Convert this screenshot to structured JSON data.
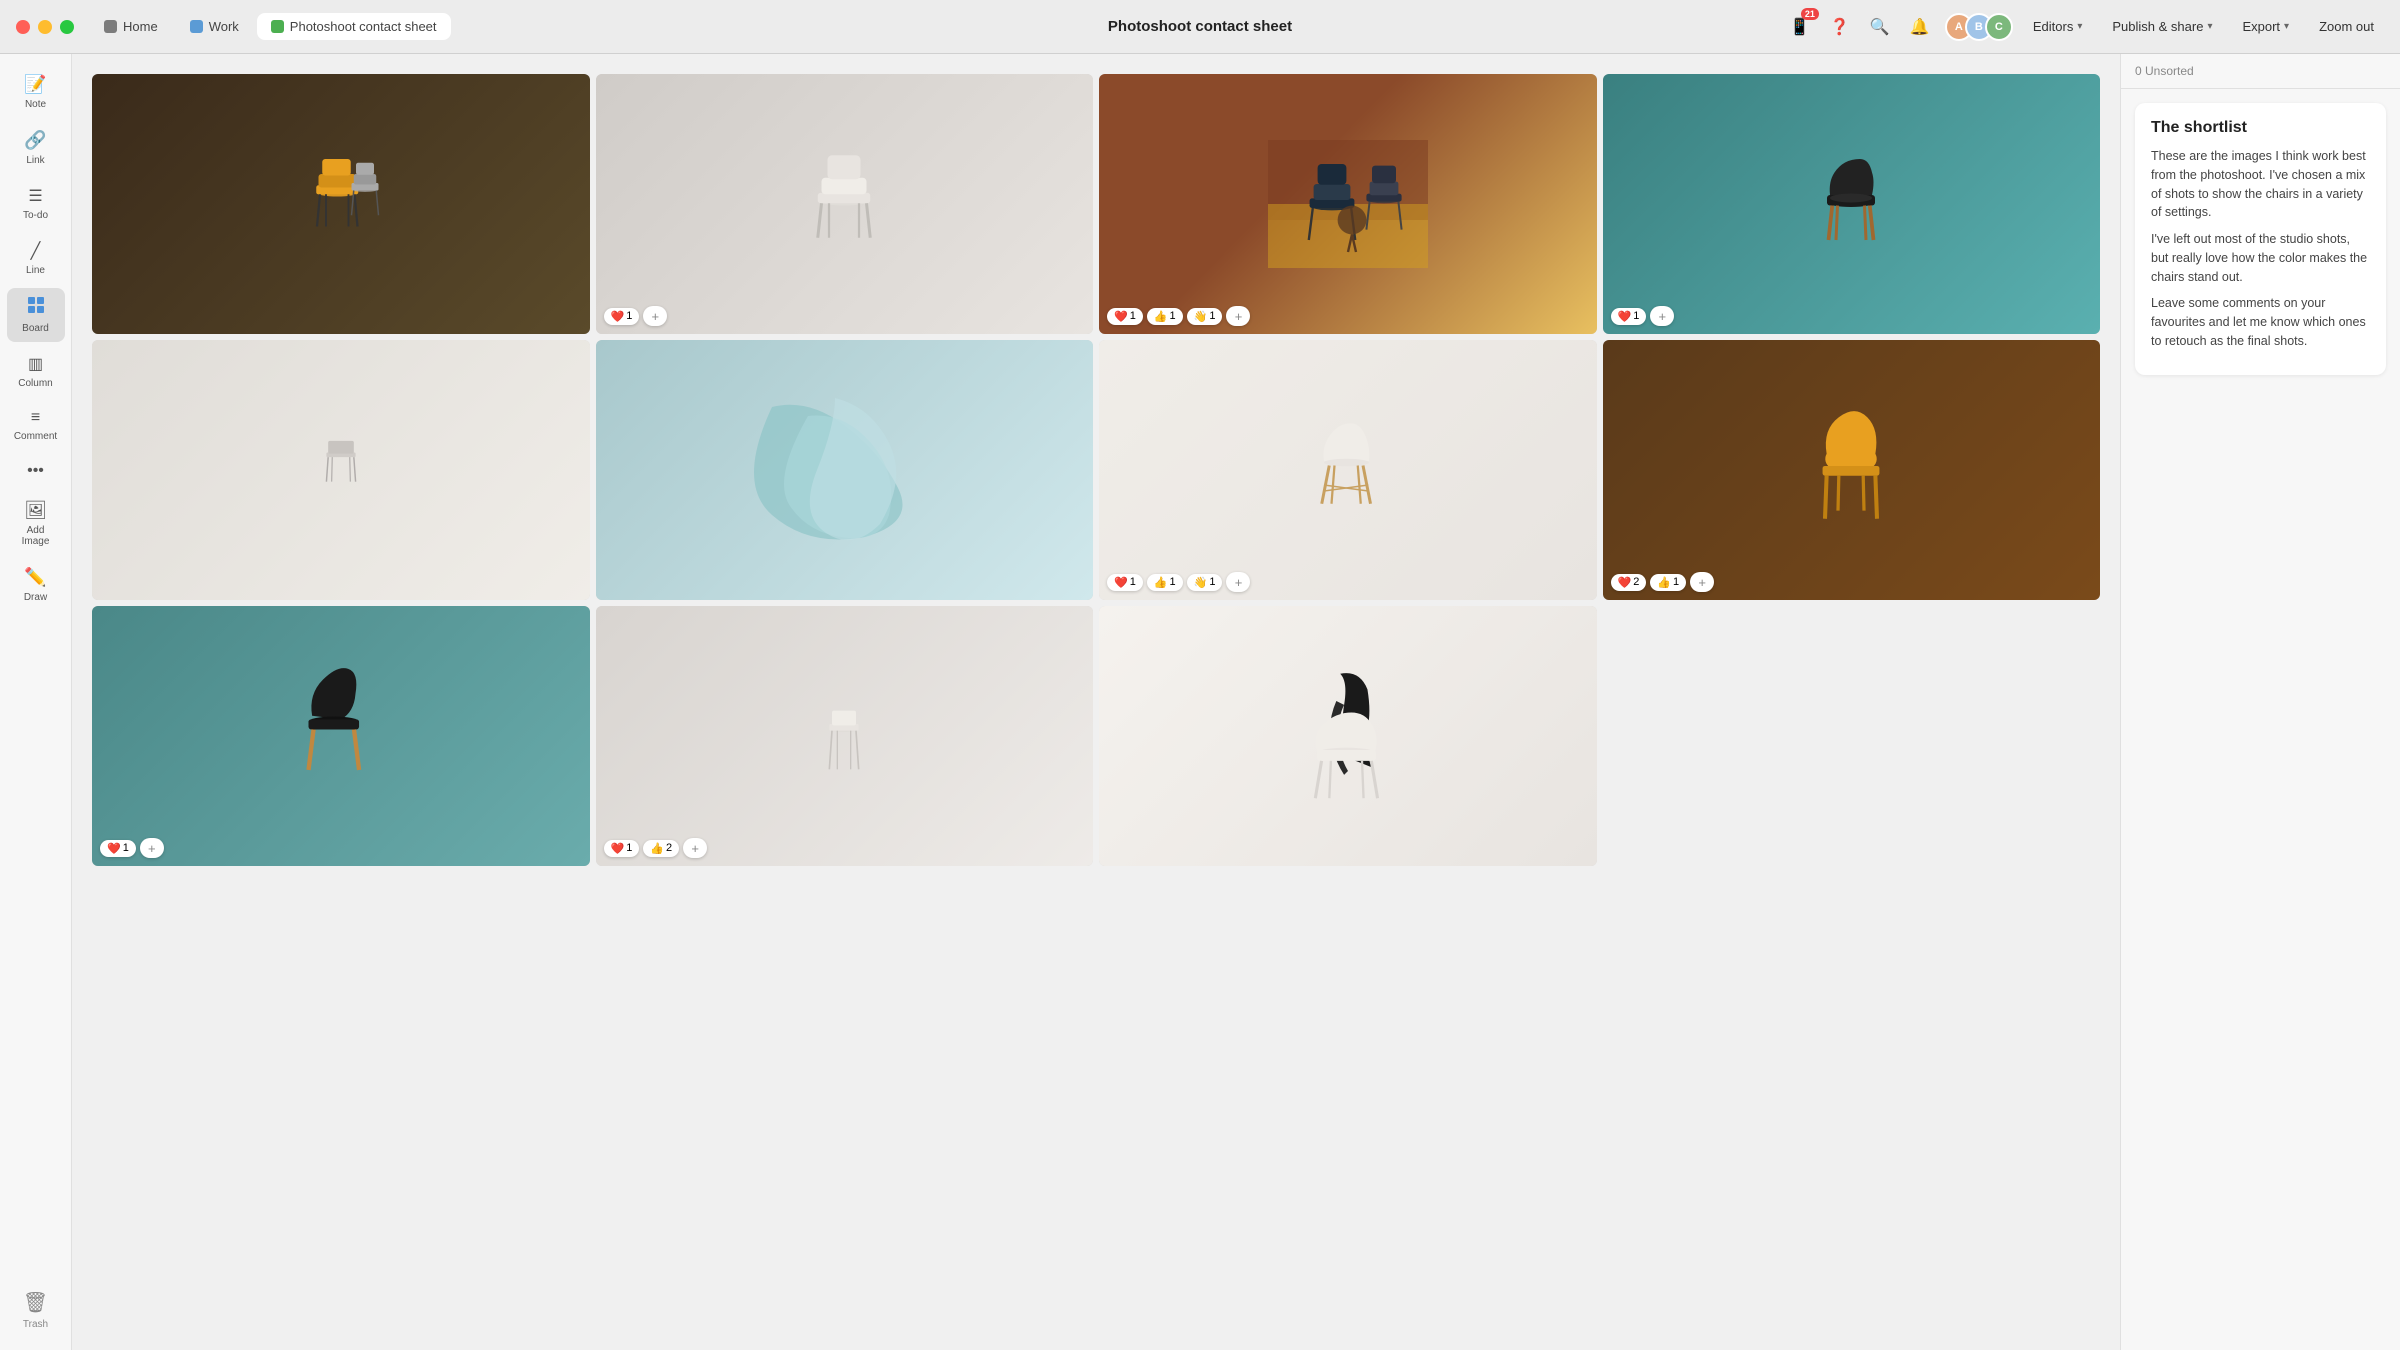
{
  "titlebar": {
    "title": "Photoshoot contact sheet",
    "tabs": [
      {
        "id": "home",
        "label": "Home",
        "icon_color": "#7c7c7c"
      },
      {
        "id": "work",
        "label": "Work",
        "icon_color": "#5b9bd5"
      },
      {
        "id": "photoshoot",
        "label": "Photoshoot contact sheet",
        "icon_color": "#4caf50"
      }
    ],
    "notification_count": "21"
  },
  "toolbar": {
    "editors_label": "Editors",
    "publish_label": "Publish & share",
    "export_label": "Export",
    "zoom_label": "Zoom out"
  },
  "sidebar": {
    "items": [
      {
        "id": "note",
        "label": "Note",
        "icon": "📝"
      },
      {
        "id": "link",
        "label": "Link",
        "icon": "🔗"
      },
      {
        "id": "todo",
        "label": "To-do",
        "icon": "☑"
      },
      {
        "id": "line",
        "label": "Line",
        "icon": "╱"
      },
      {
        "id": "board",
        "label": "Board",
        "icon": "⊞",
        "active": true
      },
      {
        "id": "column",
        "label": "Column",
        "icon": "▥"
      },
      {
        "id": "comment",
        "label": "Comment",
        "icon": "≡"
      },
      {
        "id": "more",
        "label": "···",
        "icon": "···"
      },
      {
        "id": "addimage",
        "label": "Add Image",
        "icon": "🖼"
      },
      {
        "id": "draw",
        "label": "Draw",
        "icon": "✏"
      }
    ],
    "trash": {
      "label": "Trash"
    }
  },
  "board": {
    "images": [
      {
        "row": 1,
        "col": 1,
        "bg_class": "img-r1c1",
        "reactions": []
      },
      {
        "row": 1,
        "col": 2,
        "bg_class": "img-r1c2",
        "reactions": [
          {
            "emoji": "❤️",
            "count": "1"
          }
        ]
      },
      {
        "row": 1,
        "col": 3,
        "bg_class": "img-r1c3",
        "reactions": [
          {
            "emoji": "❤️",
            "count": "1"
          },
          {
            "emoji": "👍",
            "count": "1"
          },
          {
            "emoji": "👋",
            "count": "1"
          }
        ]
      },
      {
        "row": 1,
        "col": 4,
        "bg_class": "img-r1c4",
        "reactions": [
          {
            "emoji": "❤️",
            "count": "1"
          }
        ]
      },
      {
        "row": 2,
        "col": 1,
        "bg_class": "img-r2c1",
        "reactions": []
      },
      {
        "row": 2,
        "col": 2,
        "bg_class": "img-r2c2",
        "reactions": []
      },
      {
        "row": 2,
        "col": 3,
        "bg_class": "img-r2c3",
        "reactions": [
          {
            "emoji": "❤️",
            "count": "1"
          },
          {
            "emoji": "👍",
            "count": "1"
          },
          {
            "emoji": "👋",
            "count": "1"
          }
        ]
      },
      {
        "row": 2,
        "col": 4,
        "bg_class": "img-r2c4",
        "reactions": [
          {
            "emoji": "❤️",
            "count": "2"
          },
          {
            "emoji": "👍",
            "count": "1"
          }
        ]
      },
      {
        "row": 3,
        "col": 1,
        "bg_class": "img-r3c1",
        "reactions": []
      },
      {
        "row": 3,
        "col": 2,
        "bg_class": "img-r3c2",
        "reactions": []
      },
      {
        "row": 3,
        "col": 3,
        "bg_class": "img-r3c3",
        "reactions": []
      }
    ]
  },
  "right_panel": {
    "unsorted_label": "0 Unsorted",
    "shortlist": {
      "title": "The shortlist",
      "paragraphs": [
        "These are the images I think work best from the photoshoot. I've chosen a mix of shots to show the chairs in a variety of settings.",
        "I've left out most of the studio shots, but really love how the color makes the chairs stand out.",
        "Leave some comments on your favourites and let me know which ones to retouch as the final shots."
      ]
    }
  }
}
